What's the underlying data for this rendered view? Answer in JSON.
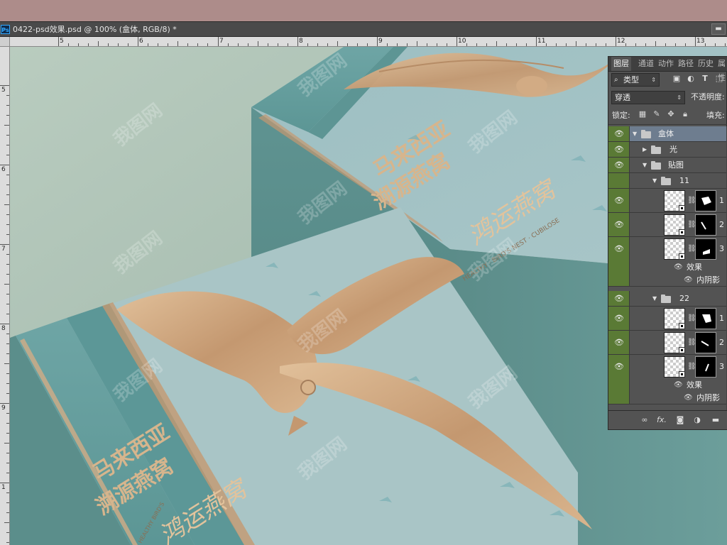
{
  "app": {
    "badge": "Ps",
    "doc_title": "0422-psd效果.psd @ 100% (盒体, RGB/8) *",
    "minimize_label": "▬"
  },
  "rulers": {
    "h_labels": [
      "5",
      "6",
      "7",
      "8",
      "9",
      "10",
      "11",
      "12",
      "13"
    ],
    "v_labels": [
      "5",
      "6",
      "7",
      "8",
      "9",
      "1"
    ]
  },
  "artwork": {
    "brand_cn_1": "马来西亚",
    "brand_cn_2": "溯源燕窝",
    "brand_cn_3": "马来西亚",
    "brand_cn_4": "溯源燕窝",
    "logo_script_1": "鸿运燕窝",
    "logo_script_2": "鸿运燕窝",
    "logo_en_1": "HEALTHY · BIRD'S NEST · CUBILOSE",
    "logo_en_2": "HEALTHY BIRD'S",
    "watermark": "我图网"
  },
  "layers_panel": {
    "tabs": [
      "图层",
      "通道",
      "动作",
      "路径",
      "历史",
      "属性"
    ],
    "filter_kind": "类型",
    "blend_mode": "穿透",
    "opacity_label": "不透明度:",
    "lock_label": "锁定:",
    "fill_label": "填充:",
    "layers": [
      {
        "name": "盒体",
        "kind": "group"
      },
      {
        "name": "光",
        "kind": "group"
      },
      {
        "name": "贴图",
        "kind": "group"
      },
      {
        "name": "11",
        "kind": "group"
      },
      {
        "name": "1",
        "kind": "smart"
      },
      {
        "name": "2",
        "kind": "smart"
      },
      {
        "name": "3",
        "kind": "smart"
      },
      {
        "name": "效果",
        "kind": "fx"
      },
      {
        "name": "内阴影",
        "kind": "fx-item"
      },
      {
        "name": "22",
        "kind": "group"
      },
      {
        "name": "1",
        "kind": "smart"
      },
      {
        "name": "2",
        "kind": "smart"
      },
      {
        "name": "3",
        "kind": "smart"
      },
      {
        "name": "效果",
        "kind": "fx"
      },
      {
        "name": "内阴影",
        "kind": "fx-item"
      }
    ],
    "footer_icons": [
      "link-icon",
      "fx-icon",
      "mask-icon",
      "adjustment-icon",
      "folder-icon"
    ],
    "footer_fx": "fx."
  },
  "colors": {
    "accent_selected": "#6e7d8f",
    "visibility_green": "#5a7a35",
    "box_teal": "#6fa3a2",
    "gold_foil": "#c9a27a"
  }
}
